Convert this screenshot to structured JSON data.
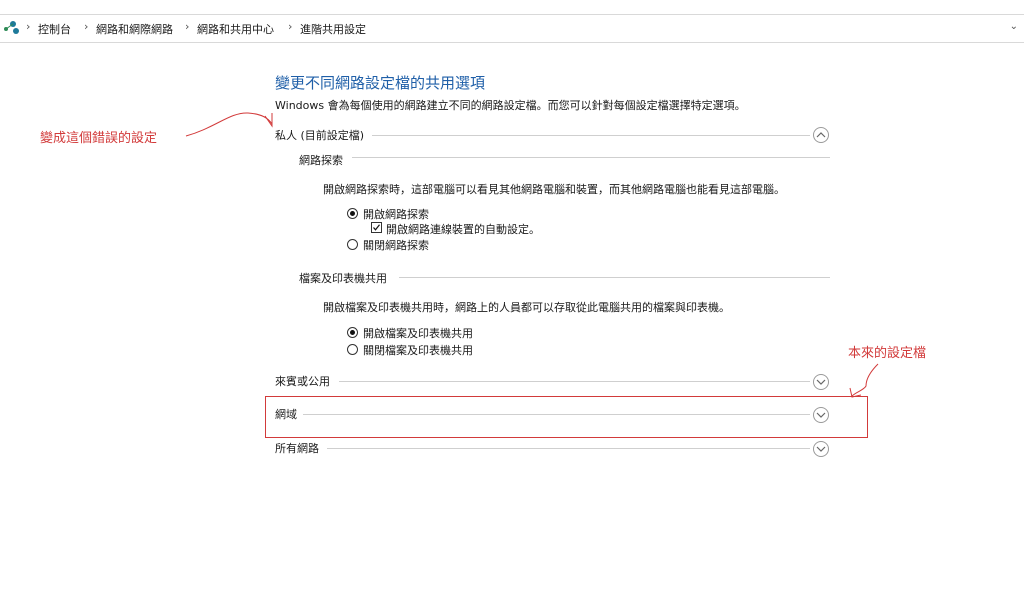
{
  "breadcrumb": {
    "items": [
      "控制台",
      "網路和網際網路",
      "網路和共用中心",
      "進階共用設定"
    ]
  },
  "title": "變更不同網路設定檔的共用選項",
  "description": "Windows 會為每個使用的網路建立不同的網路設定檔。而您可以針對每個設定檔選擇特定選項。",
  "profiles": {
    "private": {
      "label": "私人 (目前設定檔)",
      "expanded": true,
      "network_discovery": {
        "heading": "網路探索",
        "description": "開啟網路探索時，這部電腦可以看見其他網路電腦和裝置，而其他網路電腦也能看見這部電腦。",
        "on_label": "開啟網路探索",
        "auto_setup_label": "開啟網路連線裝置的自動設定。",
        "off_label": "關閉網路探索",
        "selected": "on",
        "auto_setup_checked": true
      },
      "file_sharing": {
        "heading": "檔案及印表機共用",
        "description": "開啟檔案及印表機共用時，網路上的人員都可以存取從此電腦共用的檔案與印表機。",
        "on_label": "開啟檔案及印表機共用",
        "off_label": "關閉檔案及印表機共用",
        "selected": "on"
      }
    },
    "guest": {
      "label": "來賓或公用",
      "expanded": false
    },
    "domain": {
      "label": "網域",
      "expanded": false
    },
    "all": {
      "label": "所有網路",
      "expanded": false
    }
  },
  "annotations": {
    "wrong_setting": "變成這個錯誤的設定",
    "original_profile": "本來的設定檔"
  },
  "colors": {
    "title": "#1f5fa8",
    "annotation": "#d23a3a"
  },
  "icons": {
    "network": "network-icon",
    "expand_up": "chevron-up-icon",
    "expand_down": "chevron-down-icon",
    "breadcrumb_separator": "chevron-right-icon",
    "dropdown": "chevron-down-icon"
  }
}
